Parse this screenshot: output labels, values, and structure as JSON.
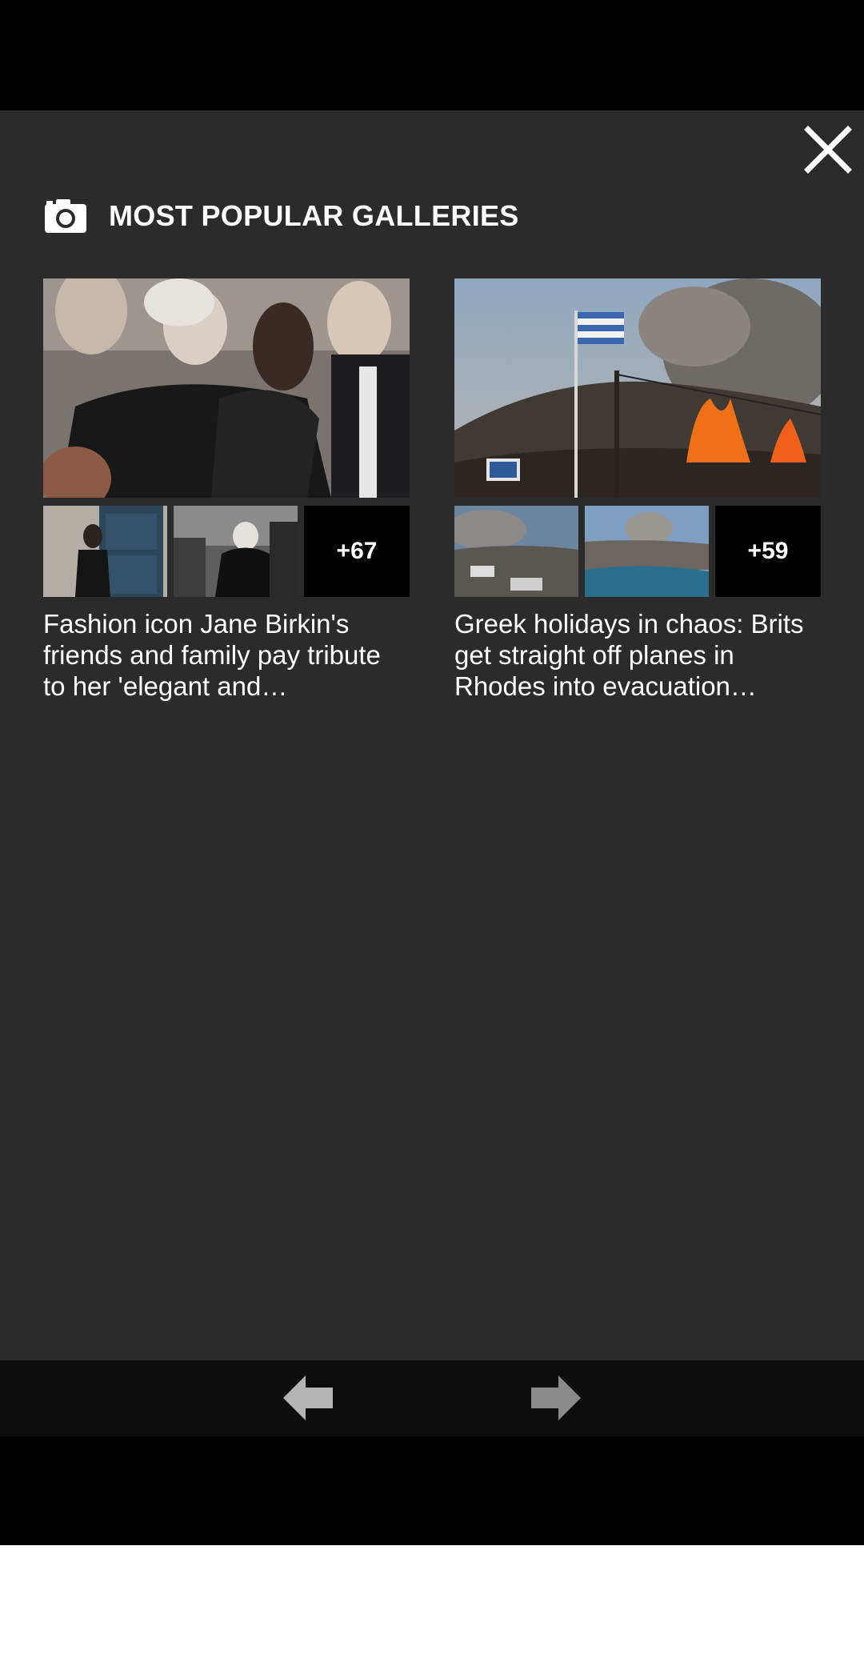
{
  "header": {
    "title": "MOST POPULAR GALLERIES",
    "close_icon": "close-icon",
    "camera_icon": "camera-icon"
  },
  "galleries": [
    {
      "caption": "Fashion icon Jane Birkin's friends and family pay tribute to her 'elegant and…",
      "more_count": "+67"
    },
    {
      "caption": "Greek holidays in chaos: Brits get straight off planes in Rhodes into evacuation…",
      "more_count": "+59"
    }
  ],
  "nav": {
    "prev_icon": "arrow-left-icon",
    "next_icon": "arrow-right-icon"
  },
  "colors": {
    "panel_bg": "#2b2b2b",
    "nav_bg": "#0e0e0e",
    "text": "#ffffff",
    "arrow": "#9a9a9a"
  }
}
